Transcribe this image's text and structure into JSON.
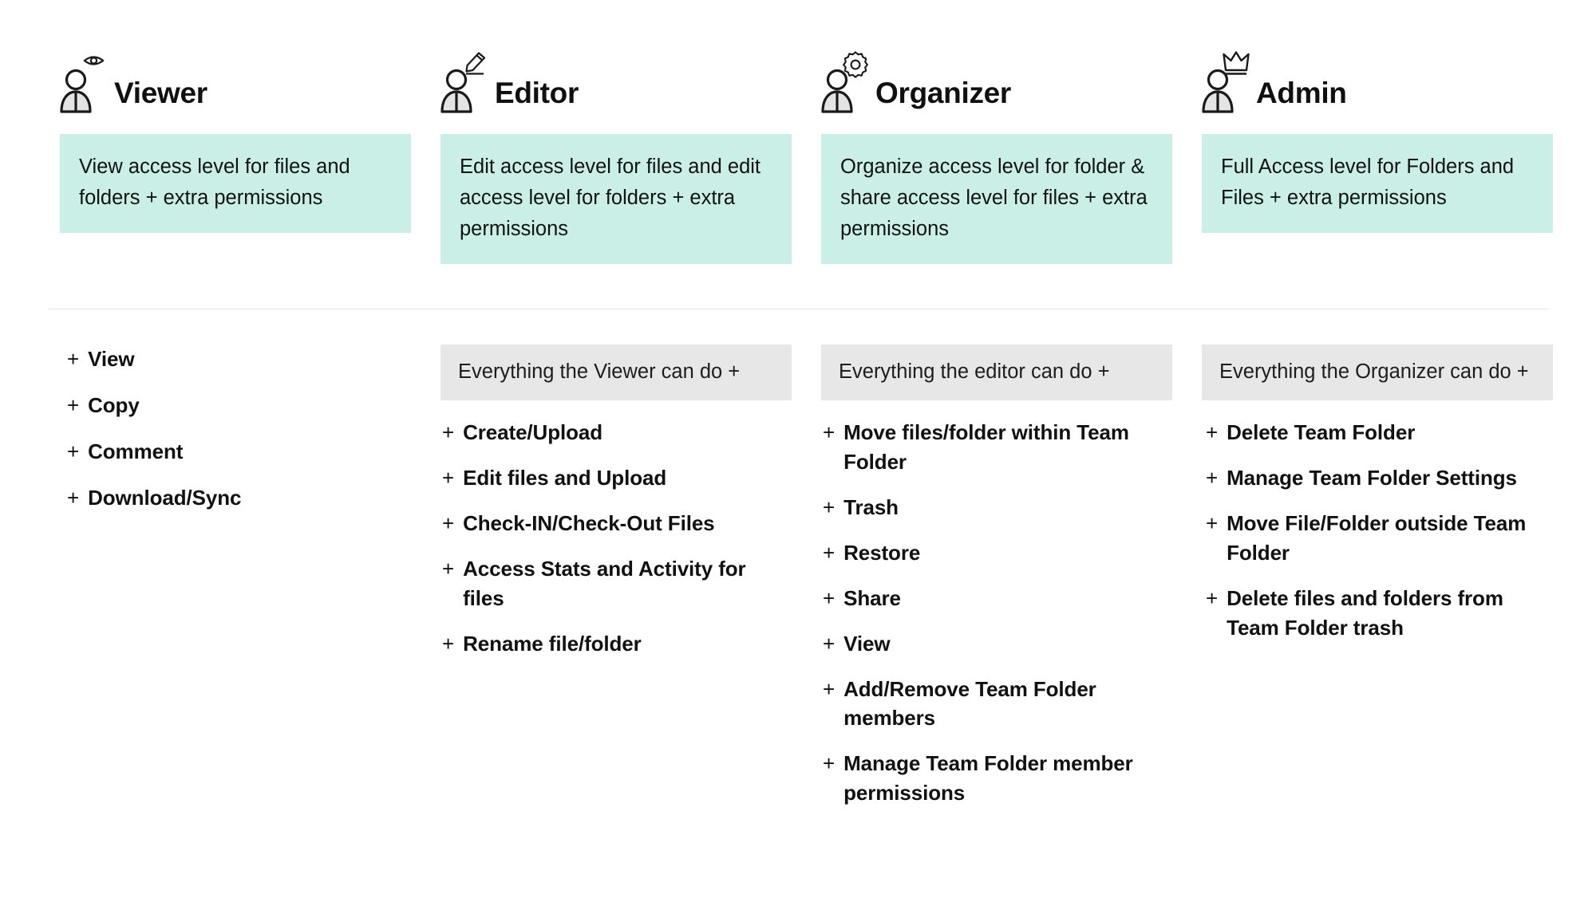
{
  "roles": [
    {
      "id": "viewer",
      "title": "Viewer",
      "icon": "user-eye-icon",
      "badge": "eye-icon",
      "description": "View access level for files and folders + extra permissions",
      "inherits_label": "",
      "permissions": [
        "View",
        "Copy",
        "Comment",
        "Download/Sync"
      ]
    },
    {
      "id": "editor",
      "title": "Editor",
      "icon": "user-pencil-icon",
      "badge": "pencil-icon",
      "description": "Edit access level for files and edit access level for folders + extra permissions",
      "inherits_label": "Everything the Viewer can do +",
      "permissions": [
        "Create/Upload",
        "Edit files and Upload",
        "Check-IN/Check-Out Files",
        "Access Stats and Activity for files",
        "Rename file/folder"
      ]
    },
    {
      "id": "organizer",
      "title": "Organizer",
      "icon": "user-gear-icon",
      "badge": "gear-icon",
      "description": "Organize access level for folder & share access level for files + extra permissions",
      "inherits_label": "Everything the editor can do +",
      "permissions": [
        "Move files/folder within Team Folder",
        "Trash",
        "Restore",
        "Share",
        "View",
        "Add/Remove Team Folder members",
        "Manage Team Folder member permissions"
      ]
    },
    {
      "id": "admin",
      "title": "Admin",
      "icon": "user-crown-icon",
      "badge": "crown-icon",
      "description": "Full Access level for Folders and Files + extra permissions",
      "inherits_label": "Everything the Organizer can do +",
      "permissions": [
        "Delete Team Folder",
        "Manage Team Folder Settings",
        "Move File/Folder outside Team Folder",
        "Delete files and folders from Team Folder trash"
      ]
    }
  ],
  "bullet_symbol": "+",
  "colors": {
    "description_box": "#c9efe6",
    "inherits_box": "#e7e7e7",
    "divider": "#e3e3e3",
    "text": "#111111",
    "page_background": "#ffffff"
  }
}
